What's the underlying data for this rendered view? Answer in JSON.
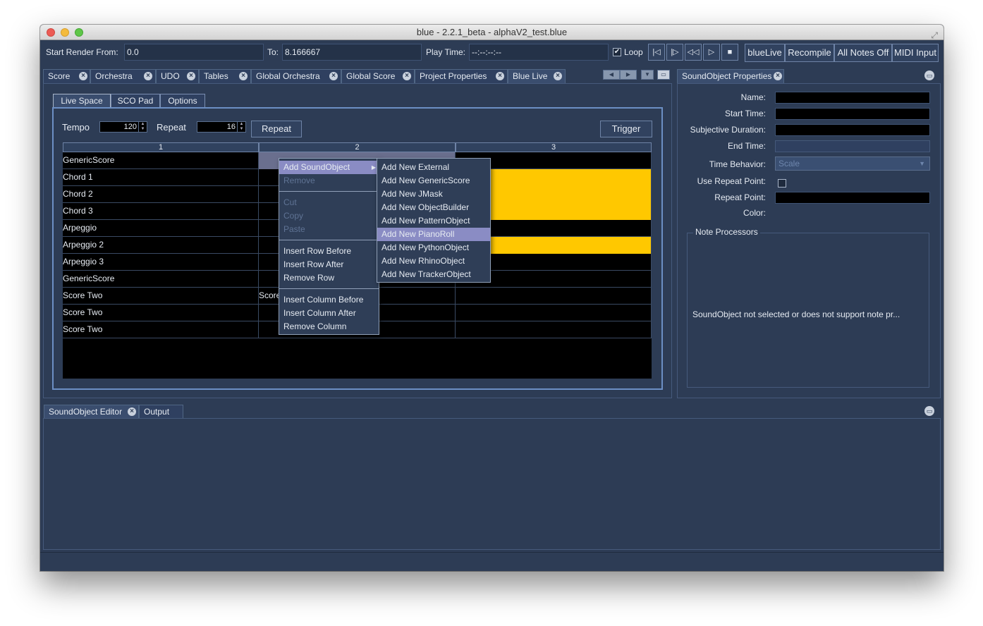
{
  "window": {
    "title": "blue - 2.2.1_beta - alphaV2_test.blue"
  },
  "toolbar": {
    "start_render_label": "Start Render From:",
    "start_render_value": "0.0",
    "to_label": "To:",
    "to_value": "8.166667",
    "play_time_label": "Play Time:",
    "play_time_value": "--:--:--:--",
    "loop_label": "Loop",
    "loop_checked": "✔",
    "buttons": [
      "blueLive",
      "Recompile",
      "All Notes Off",
      "MIDI Input"
    ],
    "transport_icons": [
      "|◁",
      "|▷",
      "◁◁",
      "▷",
      "■"
    ]
  },
  "tabs": [
    "Score",
    "Orchestra",
    "UDO",
    "Tables",
    "Global Orchestra",
    "Global Score",
    "Project Properties",
    "Blue Live"
  ],
  "active_tab": "Blue Live",
  "blue_live": {
    "subtabs": [
      "Live Space",
      "SCO Pad",
      "Options"
    ],
    "tempo_label": "Tempo",
    "tempo_value": "120",
    "repeat_label": "Repeat",
    "repeat_value": "16",
    "repeat_button": "Repeat",
    "trigger_button": "Trigger",
    "columns": [
      "1",
      "2",
      "3"
    ],
    "rows": [
      {
        "label": "GenericScore",
        "c2": "",
        "c3": "",
        "c3_yellow": false
      },
      {
        "label": "Chord 1",
        "c2": "",
        "c3": "",
        "c3_yellow": true
      },
      {
        "label": "Chord 2",
        "c2": "",
        "c3": "",
        "c3_yellow": true
      },
      {
        "label": "Chord 3",
        "c2": "",
        "c3": "",
        "c3_yellow": true
      },
      {
        "label": "Arpeggio",
        "c2": "",
        "c3": "",
        "c3_yellow": false
      },
      {
        "label": "Arpeggio 2",
        "c2": "",
        "c3": "",
        "c3_yellow": true
      },
      {
        "label": "Arpeggio 3",
        "c2": "",
        "c3": "",
        "c3_yellow": false
      },
      {
        "label": "GenericScore",
        "c2": "",
        "c3": "",
        "c3_yellow": false
      },
      {
        "label": "Score Two",
        "c2": "Score",
        "c3": "",
        "c3_yellow": false
      },
      {
        "label": "Score Two",
        "c2": "",
        "c3": "",
        "c3_yellow": false
      },
      {
        "label": "Score Two",
        "c2": "",
        "c3": "",
        "c3_yellow": false
      }
    ]
  },
  "context_menu": {
    "add_soundobject": "Add SoundObject",
    "remove": "Remove",
    "cut": "Cut",
    "copy": "Copy",
    "paste": "Paste",
    "insert_row_before": "Insert Row Before",
    "insert_row_after": "Insert Row After",
    "remove_row": "Remove Row",
    "insert_column_before": "Insert Column Before",
    "insert_column_after": "Insert Column After",
    "remove_column": "Remove Column"
  },
  "submenu": {
    "items": [
      "Add New External",
      "Add New GenericScore",
      "Add New JMask",
      "Add New ObjectBuilder",
      "Add New PatternObject",
      "Add New PianoRoll",
      "Add New PythonObject",
      "Add New RhinoObject",
      "Add New TrackerObject"
    ],
    "highlighted": "Add New PianoRoll"
  },
  "properties": {
    "tab": "SoundObject Properties",
    "name_label": "Name:",
    "start_time_label": "Start Time:",
    "subjective_duration_label": "Subjective Duration:",
    "end_time_label": "End Time:",
    "time_behavior_label": "Time Behavior:",
    "time_behavior_value": "Scale",
    "use_repeat_point_label": "Use Repeat Point:",
    "repeat_point_label": "Repeat Point:",
    "color_label": "Color:",
    "note_processors_label": "Note Processors",
    "note_processors_message": "SoundObject not selected or does not support note pr..."
  },
  "bottom": {
    "tabs": [
      "SoundObject Editor",
      "Output"
    ]
  }
}
